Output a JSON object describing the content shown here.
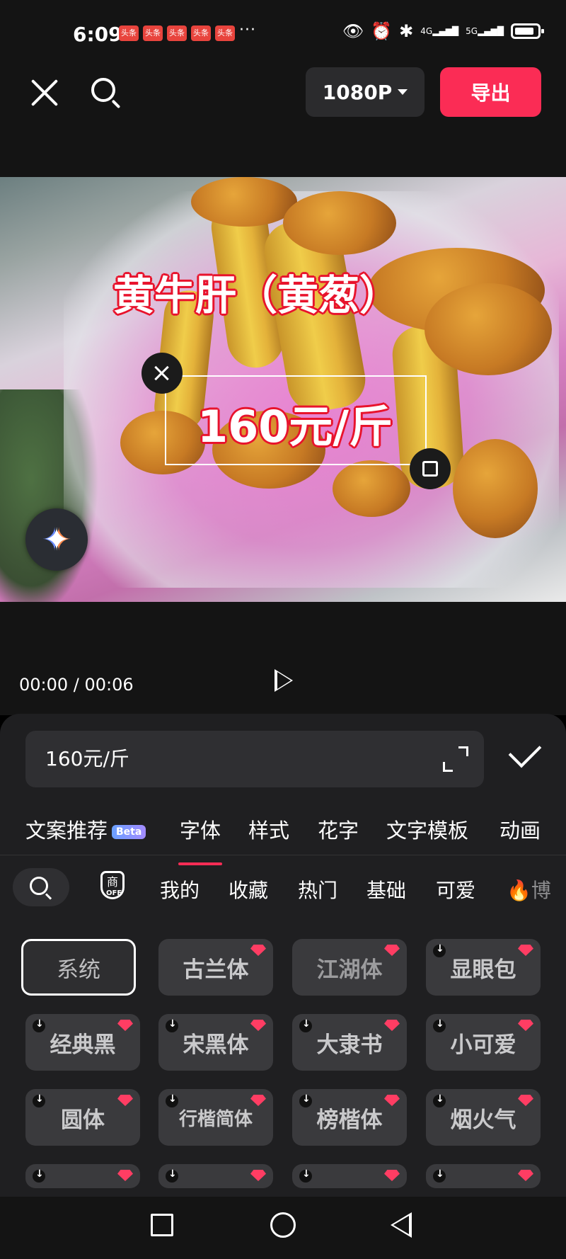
{
  "status_bar": {
    "time": "6:09",
    "notif_label": "头条",
    "more": "···",
    "net1": "4G",
    "net2": "5G"
  },
  "toolbar": {
    "resolution": "1080P",
    "export_label": "导出"
  },
  "preview": {
    "title_text": "黄牛肝（黄葱）",
    "price_text": "160元/斤"
  },
  "playback": {
    "timecode": "00:00 / 00:06"
  },
  "editor": {
    "input_value": "160元/斤"
  },
  "tabs": [
    {
      "label": "文案推荐",
      "badge": "Beta"
    },
    {
      "label": "字体"
    },
    {
      "label": "样式"
    },
    {
      "label": "花字"
    },
    {
      "label": "文字模板"
    },
    {
      "label": "动画"
    }
  ],
  "font_categories": {
    "biz": "商",
    "off": "OFF",
    "items": [
      "我的",
      "收藏",
      "热门",
      "基础",
      "可爱",
      "博"
    ]
  },
  "fonts": [
    "系统",
    "古兰体",
    "江湖体",
    "显眼包",
    "经典黑",
    "宋黑体",
    "大隶书",
    "小可爱",
    "圆体",
    "行楷简体",
    "榜楷体",
    "烟火气"
  ],
  "colors": {
    "accent": "#fb2c55",
    "background": "#1f1f21"
  }
}
